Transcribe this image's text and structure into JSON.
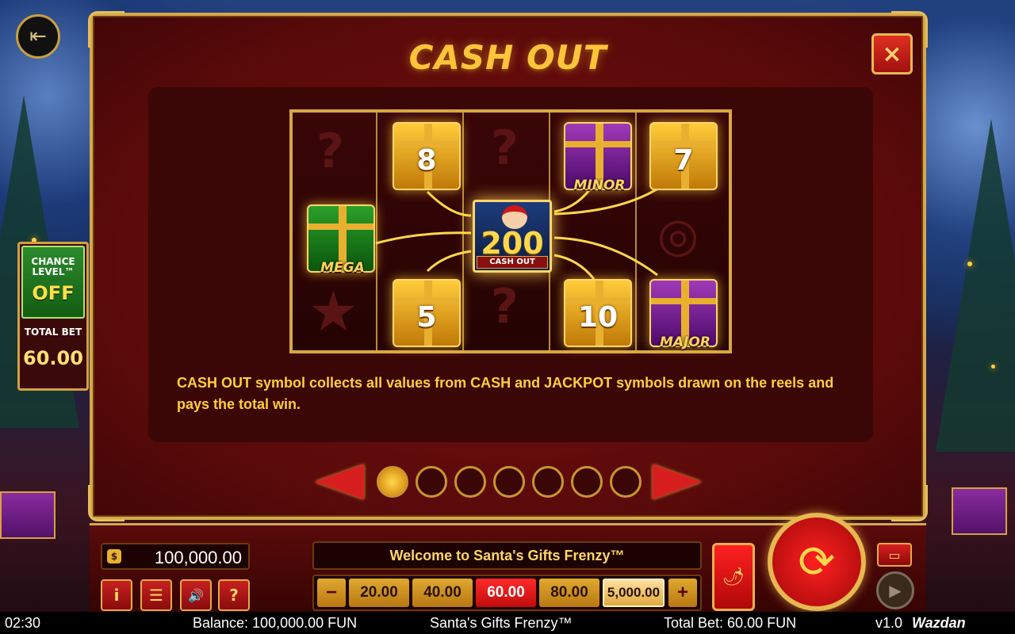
{
  "modal": {
    "title": "CASH OUT",
    "close_icon": "×",
    "description": "CASH OUT symbol collects all values from CASH and JACKPOT symbols drawn on the reels and pays the total win.",
    "illustration": {
      "gifts": [
        {
          "value": "8",
          "color": "gold"
        },
        {
          "label": "MINOR",
          "color": "purple"
        },
        {
          "value": "7",
          "color": "gold"
        },
        {
          "label": "MEGA",
          "color": "green"
        },
        {
          "value": "5",
          "color": "gold"
        },
        {
          "value": "10",
          "color": "gold"
        },
        {
          "label": "MAJOR",
          "color": "purple"
        }
      ],
      "cashout_value": "200",
      "cashout_label": "CASH OUT"
    },
    "pager": {
      "total_pages": 7,
      "current_page": 1,
      "prev_icon": "arrow-left",
      "next_icon": "arrow-right"
    }
  },
  "side_panel": {
    "chance_label": "CHANCE LEVEL™",
    "chance_value": "OFF",
    "total_bet_label": "TOTAL BET",
    "total_bet_value": "60.00"
  },
  "bottom_bar": {
    "balance": "100,000.00",
    "message": "Welcome to Santa's Gifts Frenzy™",
    "bet_options": [
      "20.00",
      "40.00",
      "60.00",
      "80.00",
      "5,000.00"
    ],
    "selected_bet": "60.00",
    "minus_label": "−",
    "plus_label": "+",
    "tools": {
      "info": "i",
      "menu": "☰",
      "sound": "🔊",
      "help": "?"
    }
  },
  "status_bar": {
    "time": "02:30",
    "balance": "Balance: 100,000.00 FUN",
    "game": "Santa's Gifts Frenzy™",
    "total_bet": "Total Bet: 60.00 FUN",
    "version": "v1.0",
    "brand": "Wazdan"
  },
  "colors": {
    "accent_gold": "#ffc43a",
    "frame_gold": "#d6a848",
    "panel_red": "#5a0a0a",
    "selected_bet": "#ff2a2a"
  }
}
